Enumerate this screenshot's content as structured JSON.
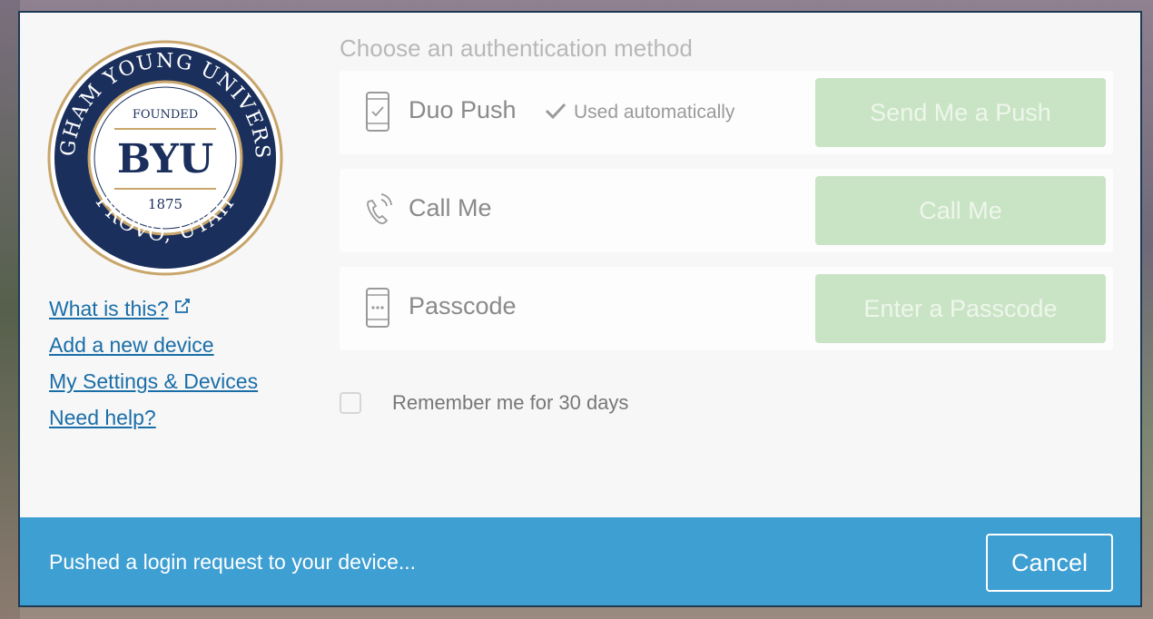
{
  "logo": {
    "arc_top": "BRIGHAM YOUNG UNIVERSITY",
    "arc_bottom": "PROVO, UTAH",
    "founded": "FOUNDED",
    "initials": "BYU",
    "year": "1875",
    "colors": {
      "navy": "#1b2f5c",
      "gold": "#c8a56a"
    }
  },
  "links": [
    {
      "label": "What is this?",
      "icon": "external-link-icon"
    },
    {
      "label": "Add a new device"
    },
    {
      "label": "My Settings & Devices"
    },
    {
      "label": "Need help?"
    }
  ],
  "heading": "Choose an authentication method",
  "methods": [
    {
      "label": "Duo Push",
      "icon": "phone-check-icon",
      "note": "Used automatically",
      "button": "Send Me a Push"
    },
    {
      "label": "Call Me",
      "icon": "phone-call-icon",
      "button": "Call Me"
    },
    {
      "label": "Passcode",
      "icon": "phone-passcode-icon",
      "button": "Enter a Passcode"
    }
  ],
  "remember": {
    "label": "Remember me for 30 days",
    "checked": false
  },
  "status": {
    "message": "Pushed a login request to your device...",
    "cancel_label": "Cancel"
  },
  "colors": {
    "status_bar": "#3e9fd3",
    "button_disabled": "#c9e4c4",
    "link": "#1a6ea8"
  }
}
